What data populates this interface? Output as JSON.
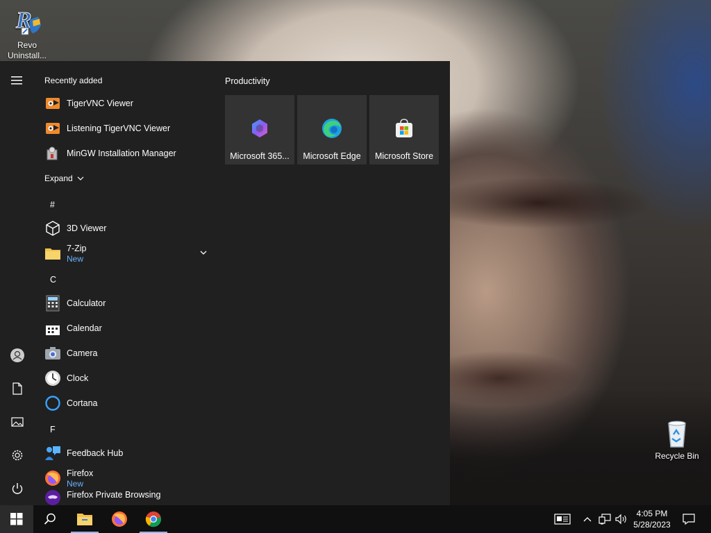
{
  "desktop": {
    "icons": [
      {
        "label": "Revo\nUninstall...",
        "name": "revo-uninstaller"
      },
      {
        "label": "Recycle Bin",
        "name": "recycle-bin"
      }
    ]
  },
  "start_menu": {
    "recently_added": {
      "title": "Recently added",
      "items": [
        {
          "label": "TigerVNC Viewer",
          "icon": "tigervnc-icon"
        },
        {
          "label": "Listening TigerVNC Viewer",
          "icon": "tigervnc-icon"
        },
        {
          "label": "MinGW Installation Manager",
          "icon": "mingw-icon"
        }
      ],
      "expand_label": "Expand"
    },
    "all_apps": [
      {
        "letter": "#"
      },
      {
        "label": "3D Viewer",
        "icon": "cube-icon"
      },
      {
        "label": "7-Zip",
        "sub": "New",
        "icon": "folder-icon",
        "expandable": true
      },
      {
        "letter": "C"
      },
      {
        "label": "Calculator",
        "icon": "calculator-icon"
      },
      {
        "label": "Calendar",
        "icon": "calendar-icon"
      },
      {
        "label": "Camera",
        "icon": "camera-icon"
      },
      {
        "label": "Clock",
        "icon": "clock-icon"
      },
      {
        "label": "Cortana",
        "icon": "cortana-icon"
      },
      {
        "letter": "F"
      },
      {
        "label": "Feedback Hub",
        "icon": "feedback-icon"
      },
      {
        "label": "Firefox",
        "sub": "New",
        "icon": "firefox-icon"
      },
      {
        "label": "Firefox Private Browsing",
        "icon": "firefox-private-icon"
      }
    ],
    "tiles_group": {
      "title": "Productivity",
      "tiles": [
        {
          "label": "Microsoft 365...",
          "icon": "m365-icon"
        },
        {
          "label": "Microsoft Edge",
          "icon": "edge-icon"
        },
        {
          "label": "Microsoft Store",
          "icon": "store-icon"
        }
      ]
    },
    "rail": [
      "hamburger-icon",
      "user-icon",
      "document-icon",
      "pictures-icon",
      "settings-icon",
      "power-icon"
    ]
  },
  "taskbar": {
    "pinned": [
      "start-icon",
      "search-icon",
      "file-explorer-icon",
      "firefox-icon",
      "chrome-icon"
    ],
    "tray": [
      "news-icon",
      "chevron-up-icon",
      "network-icon",
      "volume-icon"
    ],
    "time": "4:05 PM",
    "date": "5/28/2023",
    "active_app": "Chrome"
  },
  "colors": {
    "menu_bg": "#202020",
    "tile_bg": "#333333",
    "taskbar_bg": "#101010",
    "accent_text": "#6ab0ff"
  }
}
